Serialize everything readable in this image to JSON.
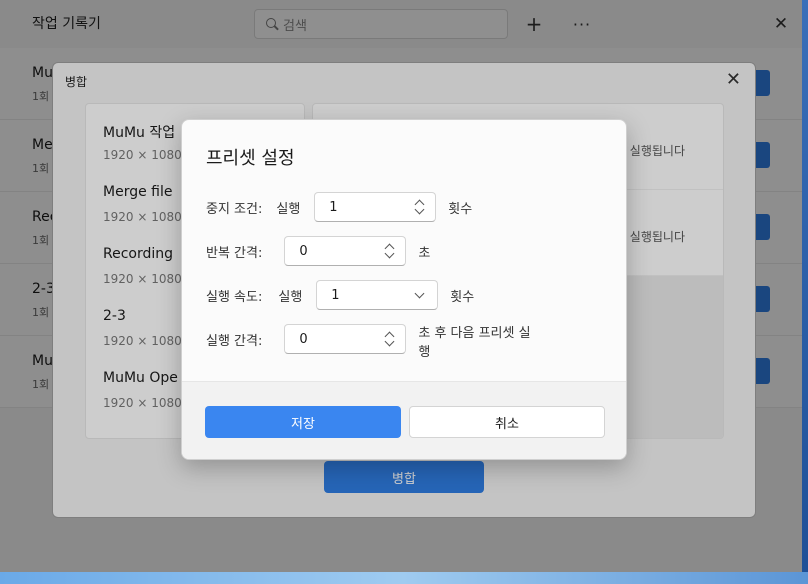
{
  "app": {
    "title": "작업 기록기",
    "search_placeholder": "검색",
    "add_icon": "plus-icon",
    "more_icon": "more-icon",
    "close_icon": "close-icon"
  },
  "list": [
    {
      "name": "Mu",
      "sub": "1회"
    },
    {
      "name": "Me",
      "sub": "1회"
    },
    {
      "name": "Rec",
      "sub": "1회"
    },
    {
      "name": "2-3",
      "sub": "1회"
    },
    {
      "name": "Mu",
      "sub": "1회"
    }
  ],
  "merge": {
    "title": "병합",
    "items": [
      {
        "name": "MuMu 작업",
        "res": "1920 × 1080"
      },
      {
        "name": "Merge file",
        "res": "1920 × 1080"
      },
      {
        "name": "Recording",
        "res": "1920 × 1080"
      },
      {
        "name": "2-3",
        "res": "1920 × 1080"
      },
      {
        "name": "MuMu Ope",
        "res": "1920 × 1080"
      }
    ],
    "right_texts": [
      "실행됩니다",
      "실행됩니다"
    ],
    "merge_button": "병합"
  },
  "preset": {
    "title": "프리셋 설정",
    "stop_label": "중지 조건:",
    "stop_prefix": "실행",
    "stop_value": "1",
    "stop_suffix": "횟수",
    "repeat_label": "반복 간격:",
    "repeat_value": "0",
    "repeat_suffix": "초",
    "speed_label": "실행 속도:",
    "speed_prefix": "실행",
    "speed_value": "1",
    "speed_suffix": "횟수",
    "interval_label": "실행 간격:",
    "interval_value": "0",
    "interval_suffix": "초 후 다음 프리셋 실행",
    "save_button": "저장",
    "cancel_button": "취소"
  },
  "colors": {
    "accent": "#3a86f0",
    "desktop": "#2a5fa8"
  }
}
